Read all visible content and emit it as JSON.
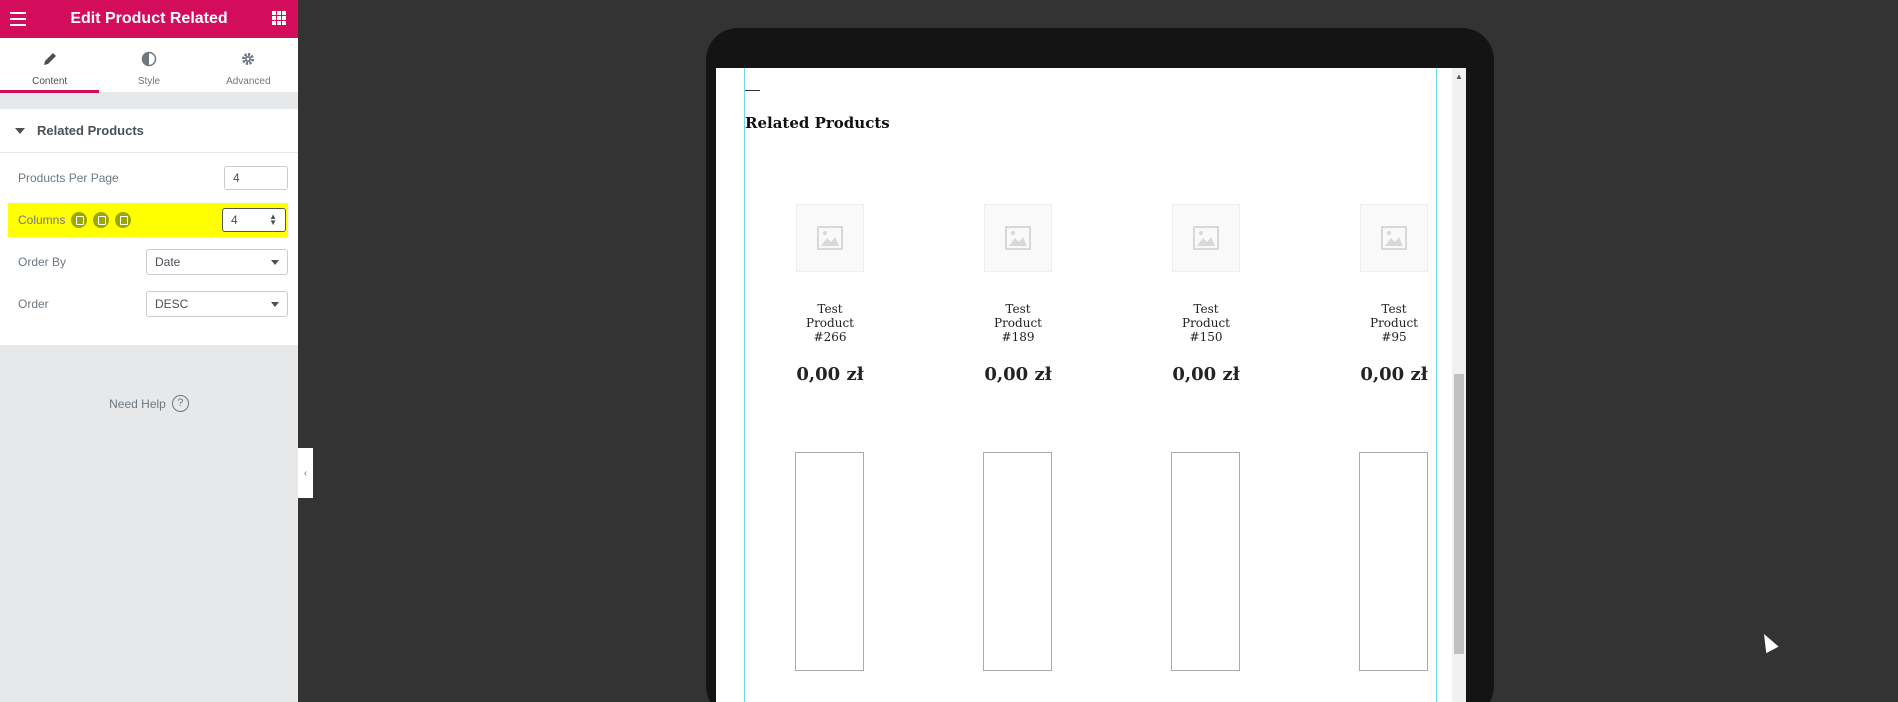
{
  "header": {
    "title": "Edit Product Related"
  },
  "tabs": [
    {
      "label": "Content"
    },
    {
      "label": "Style"
    },
    {
      "label": "Advanced"
    }
  ],
  "section": {
    "title": "Related Products",
    "products_per_page": {
      "label": "Products Per Page",
      "value": "4"
    },
    "columns": {
      "label": "Columns",
      "value": "4"
    },
    "order_by": {
      "label": "Order By",
      "value": "Date"
    },
    "order": {
      "label": "Order",
      "value": "DESC"
    }
  },
  "help": {
    "label": "Need Help",
    "icon": "?"
  },
  "preview": {
    "heading": "Related Products",
    "products": [
      {
        "name": "Test Product #266",
        "price": "0,00 zł"
      },
      {
        "name": "Test Product #189",
        "price": "0,00 zł"
      },
      {
        "name": "Test Product #150",
        "price": "0,00 zł"
      },
      {
        "name": "Test Product #95",
        "price": "0,00 zł"
      }
    ]
  },
  "colors": {
    "accent": "#d30c5c",
    "highlight": "#ffff00",
    "widget_outline": "#71d7f7"
  }
}
